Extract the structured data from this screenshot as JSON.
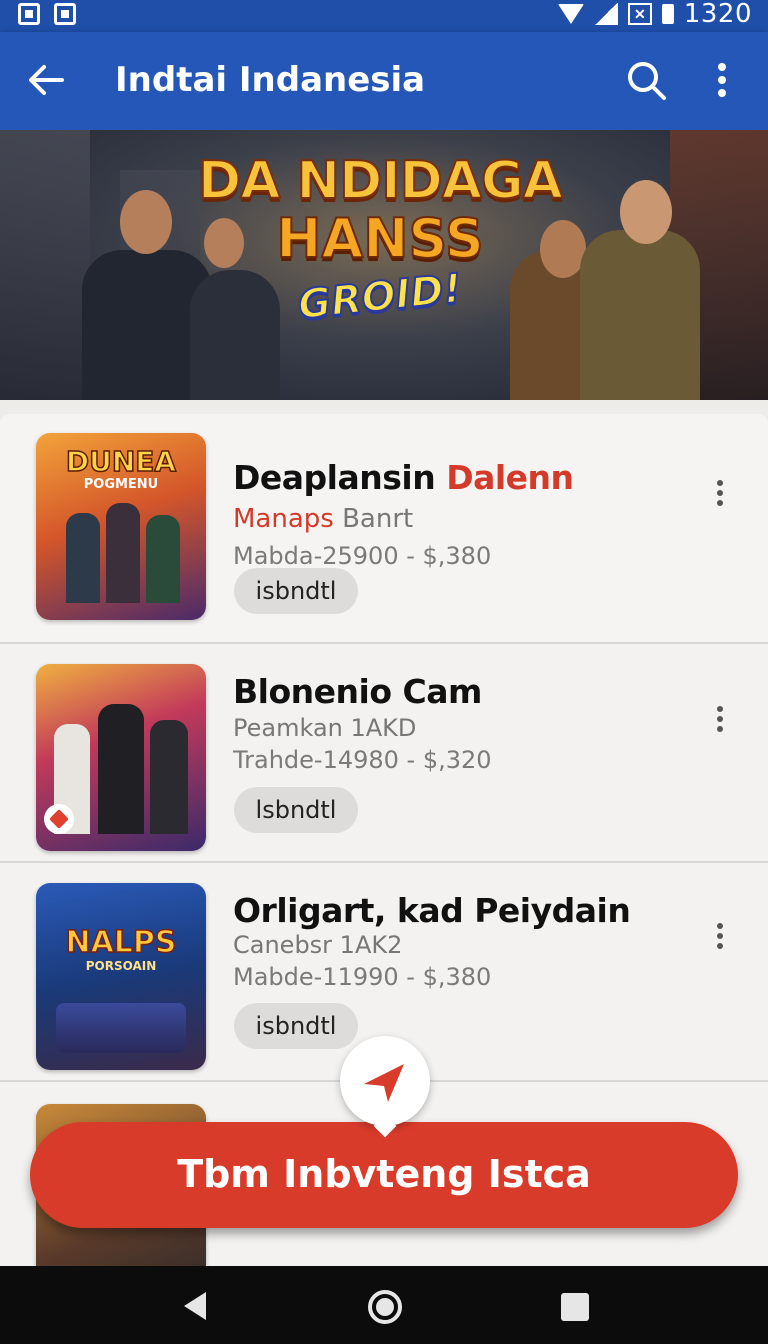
{
  "status_bar": {
    "time": "1320"
  },
  "app_bar": {
    "title": "Indtai Indanesia"
  },
  "banner": {
    "line1": "DA NDIDAGA",
    "line2": "HANSS",
    "line3": "GROID!"
  },
  "items": [
    {
      "title": "Deaplansin ",
      "title_highlight": "Dalenn",
      "subtitle": "Manaps",
      "subtitle_rest": " Banrt",
      "price": "Mabda-25900 - $,380",
      "chip": "isbndtl",
      "thumb_text1": "DUNEA",
      "thumb_text2": "POGMENU"
    },
    {
      "title": "Blonenio Cam",
      "subtitle": "Peamkan 1AKD",
      "price": "Trahde-14980 - $,320",
      "chip": "lsbndtl"
    },
    {
      "title": "Orligart, kad Peiydain",
      "subtitle": "Canebsr 1AK2",
      "price": "Mabde-11990 - $,380",
      "chip": "isbndtl",
      "thumb_text1": "NALPS",
      "thumb_text2": "PORSOAIN"
    }
  ],
  "cta": {
    "label": "Tbm Inbvteng Istca"
  },
  "colors": {
    "app_bar": "#2457b8",
    "accent": "#d93b2a"
  }
}
